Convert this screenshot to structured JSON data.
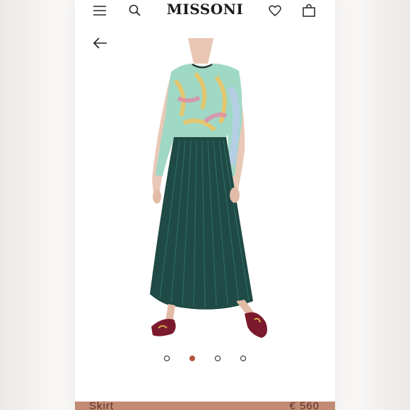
{
  "header": {
    "brand": "MISSONI",
    "icons": [
      "menu-icon",
      "search-icon",
      "heart-icon",
      "bag-icon"
    ]
  },
  "navigation": {
    "back_icon": "back-arrow-icon"
  },
  "gallery": {
    "image_count": 4,
    "active_index": 1,
    "accent_color": "#b5533c"
  },
  "product": {
    "name": "Skirt",
    "price": "€ 560"
  }
}
